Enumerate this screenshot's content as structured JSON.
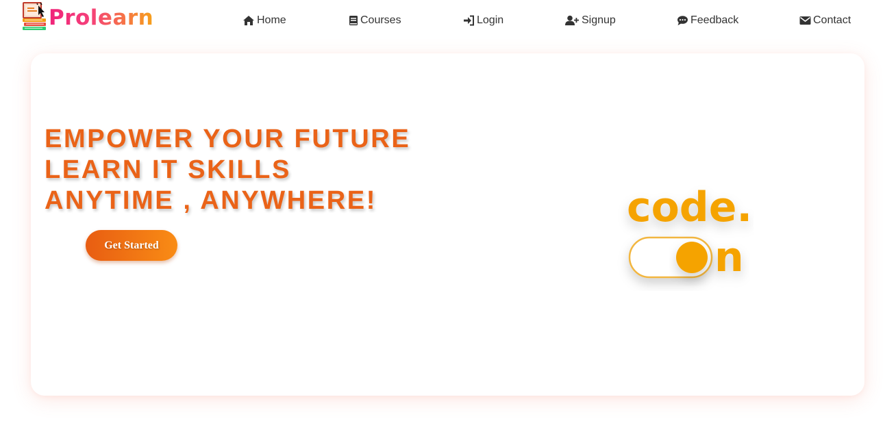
{
  "brand": {
    "name": "Prolearn",
    "gradient_start": "#f0247a",
    "gradient_end": "#f6a11a"
  },
  "nav": {
    "items": [
      {
        "label": "Home",
        "icon": "home-icon"
      },
      {
        "label": "Courses",
        "icon": "book-icon"
      },
      {
        "label": "Login",
        "icon": "sign-in-icon"
      },
      {
        "label": "Signup",
        "icon": "user-plus-icon"
      },
      {
        "label": "Feedback",
        "icon": "comment-icon"
      },
      {
        "label": "Contact",
        "icon": "envelope-icon"
      }
    ]
  },
  "hero": {
    "headline_lines": [
      "EMPOWER YOUR FUTURE",
      "LEARN IT SKILLS",
      "ANYTIME , ANYWHERE!"
    ],
    "cta_label": "Get Started",
    "illustration": {
      "word": "code.",
      "suffix": "n",
      "toggle_state": "on"
    }
  },
  "colors": {
    "accent": "#ea6318",
    "cta_start": "#e85d12",
    "cta_end": "#f98c15",
    "illustration": "#f5a300",
    "text": "#333333"
  }
}
